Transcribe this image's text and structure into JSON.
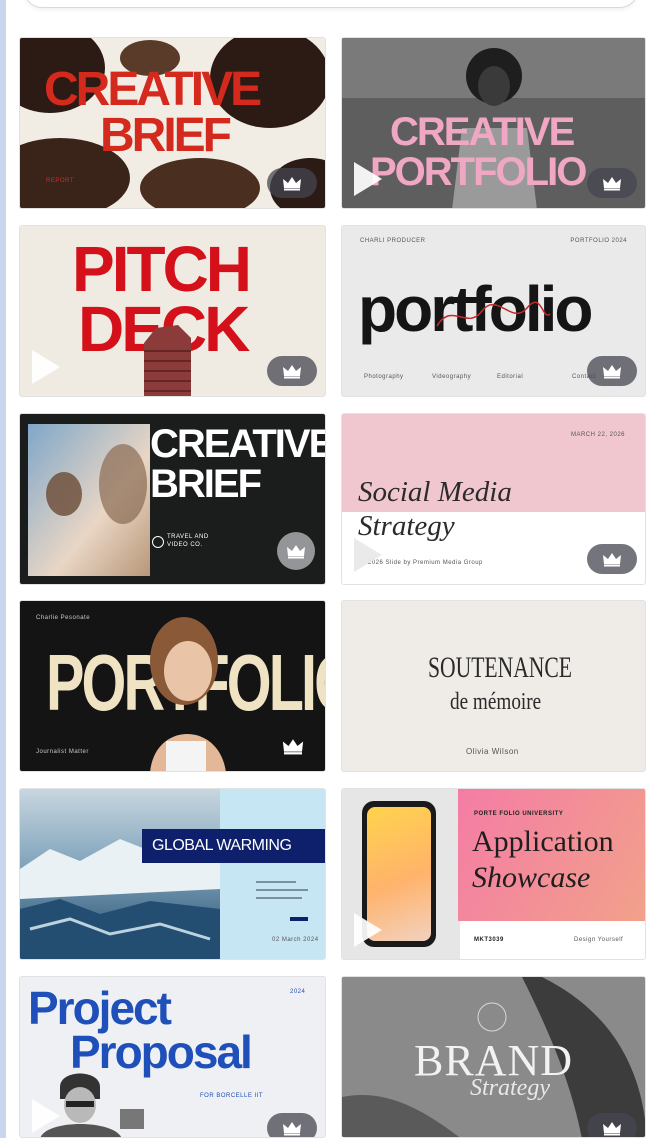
{
  "templates": [
    {
      "id": "t1",
      "title_line1": "CREATIVE",
      "title_line2": "BRIEF",
      "tag": "REPORT"
    },
    {
      "id": "t2",
      "title_line1": "CREATIVE",
      "title_line2": "PORTFOLIO"
    },
    {
      "id": "t3",
      "title_line1": "PITCH",
      "title_line2": "DECK"
    },
    {
      "id": "t4",
      "title": "portfolio",
      "header_left": "CHARLI PRODUCER",
      "header_right": "PORTFOLIO 2024",
      "footer": [
        "Photography",
        "Videography",
        "Editorial",
        "Contact"
      ]
    },
    {
      "id": "t5",
      "title_line1": "CREATIVE",
      "title_line2": "BRIEF",
      "sub": "TRAVEL AND",
      "sub2": "VIDEO CO."
    },
    {
      "id": "t6",
      "title_line1": "Social Media",
      "title_line2": "Strategy",
      "date": "MARCH 22, 2026",
      "footer": "2026 Slide by Premium Media Group"
    },
    {
      "id": "t7",
      "title": "PORTFOLIO",
      "header_left": "Charlie Pesonate",
      "footer": "Journalist Matter"
    },
    {
      "id": "t8",
      "title_line1": "SOUTENANCE",
      "title_line2": "de mémoire",
      "author": "Olivia Wilson"
    },
    {
      "id": "t9",
      "title": "GLOBAL WARMING",
      "footer": "02 March 2024"
    },
    {
      "id": "t10",
      "org": "PORTE FOLIO UNIVERSITY",
      "title_line1": "Application",
      "title_line2": "Showcase",
      "footer_left": "MKT3039",
      "footer_right": "Design Yourself"
    },
    {
      "id": "t11",
      "title_line1": "Project",
      "title_line2": "Proposal",
      "badge": "2024",
      "sub": "FOR BORCELLE IIT"
    },
    {
      "id": "t12",
      "title_line1": "BRAND",
      "title_line2": "Strategy"
    }
  ],
  "colors": {
    "crown_pill": "#4a4a55",
    "accent_red": "#d42a1e",
    "pink": "#f0a7c4",
    "blue": "#1f4fb8"
  },
  "icons": {
    "play": "play-icon",
    "premium": "crown-icon"
  }
}
